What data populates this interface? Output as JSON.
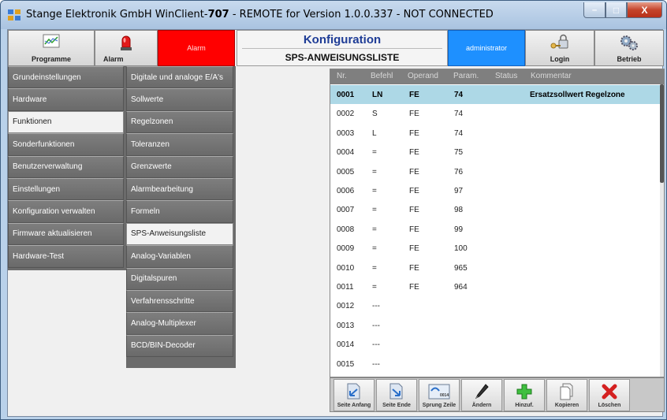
{
  "window": {
    "title_prefix": "Stange Elektronik GmbH WinClient-",
    "title_bold": "707",
    "title_suffix": " - REMOTE for Version 1.0.0.337 - NOT CONNECTED",
    "min_glyph": "–",
    "max_glyph": "□",
    "close_glyph": "X"
  },
  "header": {
    "programme_label": "Programme",
    "alarm_label": "Alarm",
    "alarm_status": "Alarm",
    "title": "Konfiguration",
    "subtitle": "SPS-ANWEISUNGSLISTE",
    "user": "administrator",
    "login_label": "Login",
    "betrieb_label": "Betrieb"
  },
  "nav_main": [
    {
      "label": "Grundeinstellungen",
      "selected": false
    },
    {
      "label": "Hardware",
      "selected": false
    },
    {
      "label": "Funktionen",
      "selected": true
    },
    {
      "label": "Sonderfunktionen",
      "selected": false
    },
    {
      "label": "Benutzerverwaltung",
      "selected": false
    },
    {
      "label": "Einstellungen",
      "selected": false
    },
    {
      "label": "Konfiguration verwalten",
      "selected": false
    },
    {
      "label": "Firmware aktualisieren",
      "selected": false
    },
    {
      "label": "Hardware-Test",
      "selected": false
    }
  ],
  "nav_sub": [
    {
      "label": "Digitale und analoge E/A's",
      "selected": false
    },
    {
      "label": "Sollwerte",
      "selected": false
    },
    {
      "label": "Regelzonen",
      "selected": false
    },
    {
      "label": "Toleranzen",
      "selected": false
    },
    {
      "label": "Grenzwerte",
      "selected": false
    },
    {
      "label": "Alarmbearbeitung",
      "selected": false
    },
    {
      "label": "Formeln",
      "selected": false
    },
    {
      "label": "SPS-Anweisungsliste",
      "selected": true
    },
    {
      "label": "Analog-Variablen",
      "selected": false
    },
    {
      "label": "Digitalspuren",
      "selected": false
    },
    {
      "label": "Verfahrensschritte",
      "selected": false
    },
    {
      "label": "Analog-Multiplexer",
      "selected": false
    },
    {
      "label": "BCD/BIN-Decoder",
      "selected": false
    }
  ],
  "table": {
    "columns": {
      "nr": "Nr.",
      "befehl": "Befehl",
      "operand": "Operand",
      "param": "Param.",
      "status": "Status",
      "kommentar": "Kommentar"
    },
    "rows": [
      {
        "nr": "0001",
        "befehl": "LN",
        "operand": "FE",
        "param": "74",
        "status": "",
        "kommentar": "Ersatzsollwert Regelzone",
        "selected": true
      },
      {
        "nr": "0002",
        "befehl": "S",
        "operand": "FE",
        "param": "74",
        "status": "",
        "kommentar": "",
        "selected": false
      },
      {
        "nr": "0003",
        "befehl": "L",
        "operand": "FE",
        "param": "74",
        "status": "",
        "kommentar": "",
        "selected": false
      },
      {
        "nr": "0004",
        "befehl": "=",
        "operand": "FE",
        "param": "75",
        "status": "",
        "kommentar": "",
        "selected": false
      },
      {
        "nr": "0005",
        "befehl": "=",
        "operand": "FE",
        "param": "76",
        "status": "",
        "kommentar": "",
        "selected": false
      },
      {
        "nr": "0006",
        "befehl": "=",
        "operand": "FE",
        "param": "97",
        "status": "",
        "kommentar": "",
        "selected": false
      },
      {
        "nr": "0007",
        "befehl": "=",
        "operand": "FE",
        "param": "98",
        "status": "",
        "kommentar": "",
        "selected": false
      },
      {
        "nr": "0008",
        "befehl": "=",
        "operand": "FE",
        "param": "99",
        "status": "",
        "kommentar": "",
        "selected": false
      },
      {
        "nr": "0009",
        "befehl": "=",
        "operand": "FE",
        "param": "100",
        "status": "",
        "kommentar": "",
        "selected": false
      },
      {
        "nr": "0010",
        "befehl": "=",
        "operand": "FE",
        "param": "965",
        "status": "",
        "kommentar": "",
        "selected": false
      },
      {
        "nr": "0011",
        "befehl": "=",
        "operand": "FE",
        "param": "964",
        "status": "",
        "kommentar": "",
        "selected": false
      },
      {
        "nr": "0012",
        "befehl": "---",
        "operand": "",
        "param": "",
        "status": "",
        "kommentar": "",
        "selected": false
      },
      {
        "nr": "0013",
        "befehl": "---",
        "operand": "",
        "param": "",
        "status": "",
        "kommentar": "",
        "selected": false
      },
      {
        "nr": "0014",
        "befehl": "---",
        "operand": "",
        "param": "",
        "status": "",
        "kommentar": "",
        "selected": false
      },
      {
        "nr": "0015",
        "befehl": "---",
        "operand": "",
        "param": "",
        "status": "",
        "kommentar": "",
        "selected": false
      }
    ]
  },
  "toolbar": {
    "seite_anfang": "Seite Anfang",
    "seite_ende": "Seite Ende",
    "sprung_zeile": "Sprung Zeile",
    "sprung_icon_text": "0014",
    "aendern": "Ändern",
    "hinzuf": "Hinzuf.",
    "kopieren": "Kopieren",
    "loeschen": "Löschen"
  },
  "colors": {
    "alarm_red": "#ff0000",
    "user_blue": "#1e90ff",
    "title_blue": "#1e3c96",
    "selected_row": "#add8e6",
    "nav_grey": "#6e6e6e"
  }
}
